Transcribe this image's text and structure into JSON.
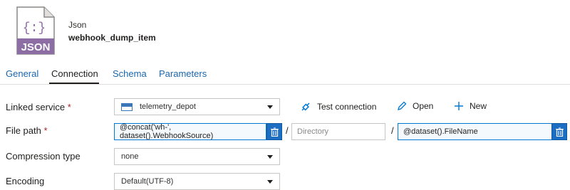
{
  "header": {
    "file_icon_text": "JSON",
    "file_icon_glyph": "{:}",
    "type": "Json",
    "name": "webhook_dump_item"
  },
  "tabs": [
    {
      "label": "General",
      "active": false
    },
    {
      "label": "Connection",
      "active": true
    },
    {
      "label": "Schema",
      "active": false
    },
    {
      "label": "Parameters",
      "active": false
    }
  ],
  "form": {
    "linked_service": {
      "label": "Linked service",
      "required": "*",
      "value": "telemetry_depot",
      "icon": "storage-icon"
    },
    "actions": {
      "test_connection": "Test connection",
      "open": "Open",
      "new": "New"
    },
    "file_path": {
      "label": "File path",
      "required": "*",
      "container": "@concat('wh-', dataset().WebhookSource)",
      "directory_placeholder": "Directory",
      "file_name": "@dataset().FileName",
      "separator": "/"
    },
    "compression_type": {
      "label": "Compression type",
      "value": "none"
    },
    "encoding": {
      "label": "Encoding",
      "value": "Default(UTF-8)"
    }
  },
  "colors": {
    "accent": "#0078d4",
    "icon_purple": "#8c6ea4",
    "required": "#a4262c"
  }
}
